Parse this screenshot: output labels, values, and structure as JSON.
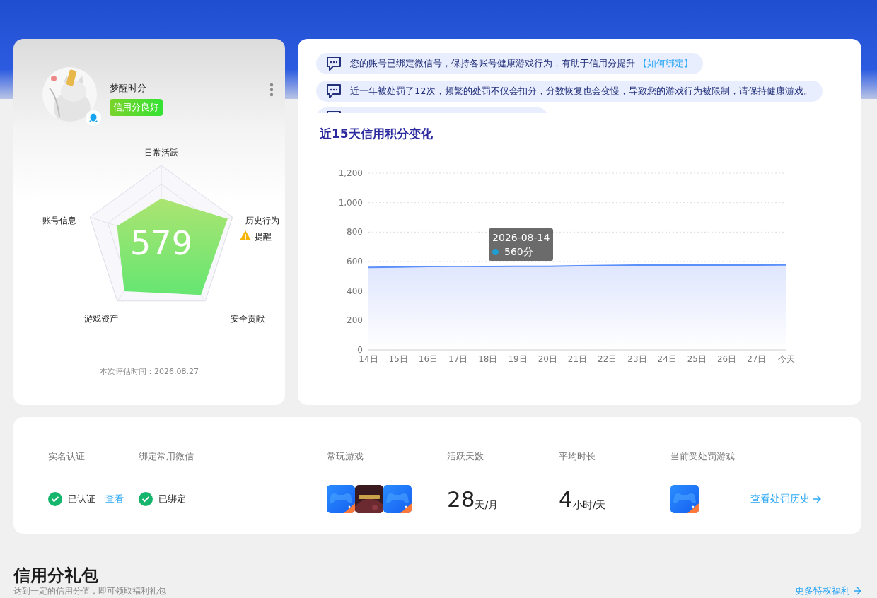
{
  "profile": {
    "name": "梦醒时分",
    "badge": "信用分良好",
    "score": "579",
    "radar": [
      {
        "label": "日常活跃"
      },
      {
        "label": "历史行为",
        "warning": "提醒"
      },
      {
        "label": "安全贡献"
      },
      {
        "label": "游戏资产"
      },
      {
        "label": "账号信息"
      }
    ],
    "eval_time": "本次评估时间：2026.08.27"
  },
  "notices": [
    {
      "text": "您的账号已绑定微信号，保持各账号健康游戏行为，有助于信用分提升 ",
      "link": "【如何绑定】"
    },
    {
      "text": "近一年被处罚了12次，频繁的处罚不仅会扣分，分数恢复也会变慢，导致您的游戏行为被限制，请保持健康游戏。"
    }
  ],
  "notice_cut_off": true,
  "trend": {
    "title": "近15天信用积分变化",
    "chart_data": {
      "type": "area",
      "categories": [
        "14日",
        "15日",
        "16日",
        "17日",
        "18日",
        "19日",
        "20日",
        "21日",
        "22日",
        "23日",
        "24日",
        "25日",
        "26日",
        "27日",
        "今天"
      ],
      "grid": true,
      "series": [
        {
          "color": "#5b8ff9",
          "values": [
            560,
            563,
            566,
            567,
            567,
            568,
            568,
            571,
            574,
            576,
            576,
            576,
            576,
            576,
            577
          ]
        }
      ],
      "ylim": [
        0,
        1200
      ],
      "yticks": [
        0,
        200,
        400,
        600,
        800,
        {
          "value": 1000,
          "label": "1,000"
        },
        {
          "value": 1200,
          "label": "1,200"
        }
      ]
    },
    "tooltip": {
      "date": "2026-08-14",
      "value": "560分"
    }
  },
  "stats": {
    "checks": [
      {
        "label": "实名认证",
        "status": "已认证",
        "link": "查看",
        "done": true
      },
      {
        "label": "绑定常用微信",
        "status": "已绑定",
        "done": true
      }
    ],
    "games_label": "常玩游戏",
    "games": [
      {
        "kind": "gamepad"
      },
      {
        "kind": "poster"
      },
      {
        "kind": "gamepad"
      }
    ],
    "metrics": [
      {
        "label": "活跃天数",
        "value": "28",
        "unit": "天/月"
      },
      {
        "label": "平均时长",
        "value": "4",
        "unit": "小时/天"
      }
    ],
    "punished_label": "当前受处罚游戏",
    "punished_games": [
      {
        "kind": "gamepad"
      }
    ],
    "history_link": "查看处罚历史"
  },
  "gifts": {
    "title": "信用分礼包",
    "subtitle": "达到一定的信用分值，即可领取福利礼包",
    "more_link": "更多特权福利"
  }
}
